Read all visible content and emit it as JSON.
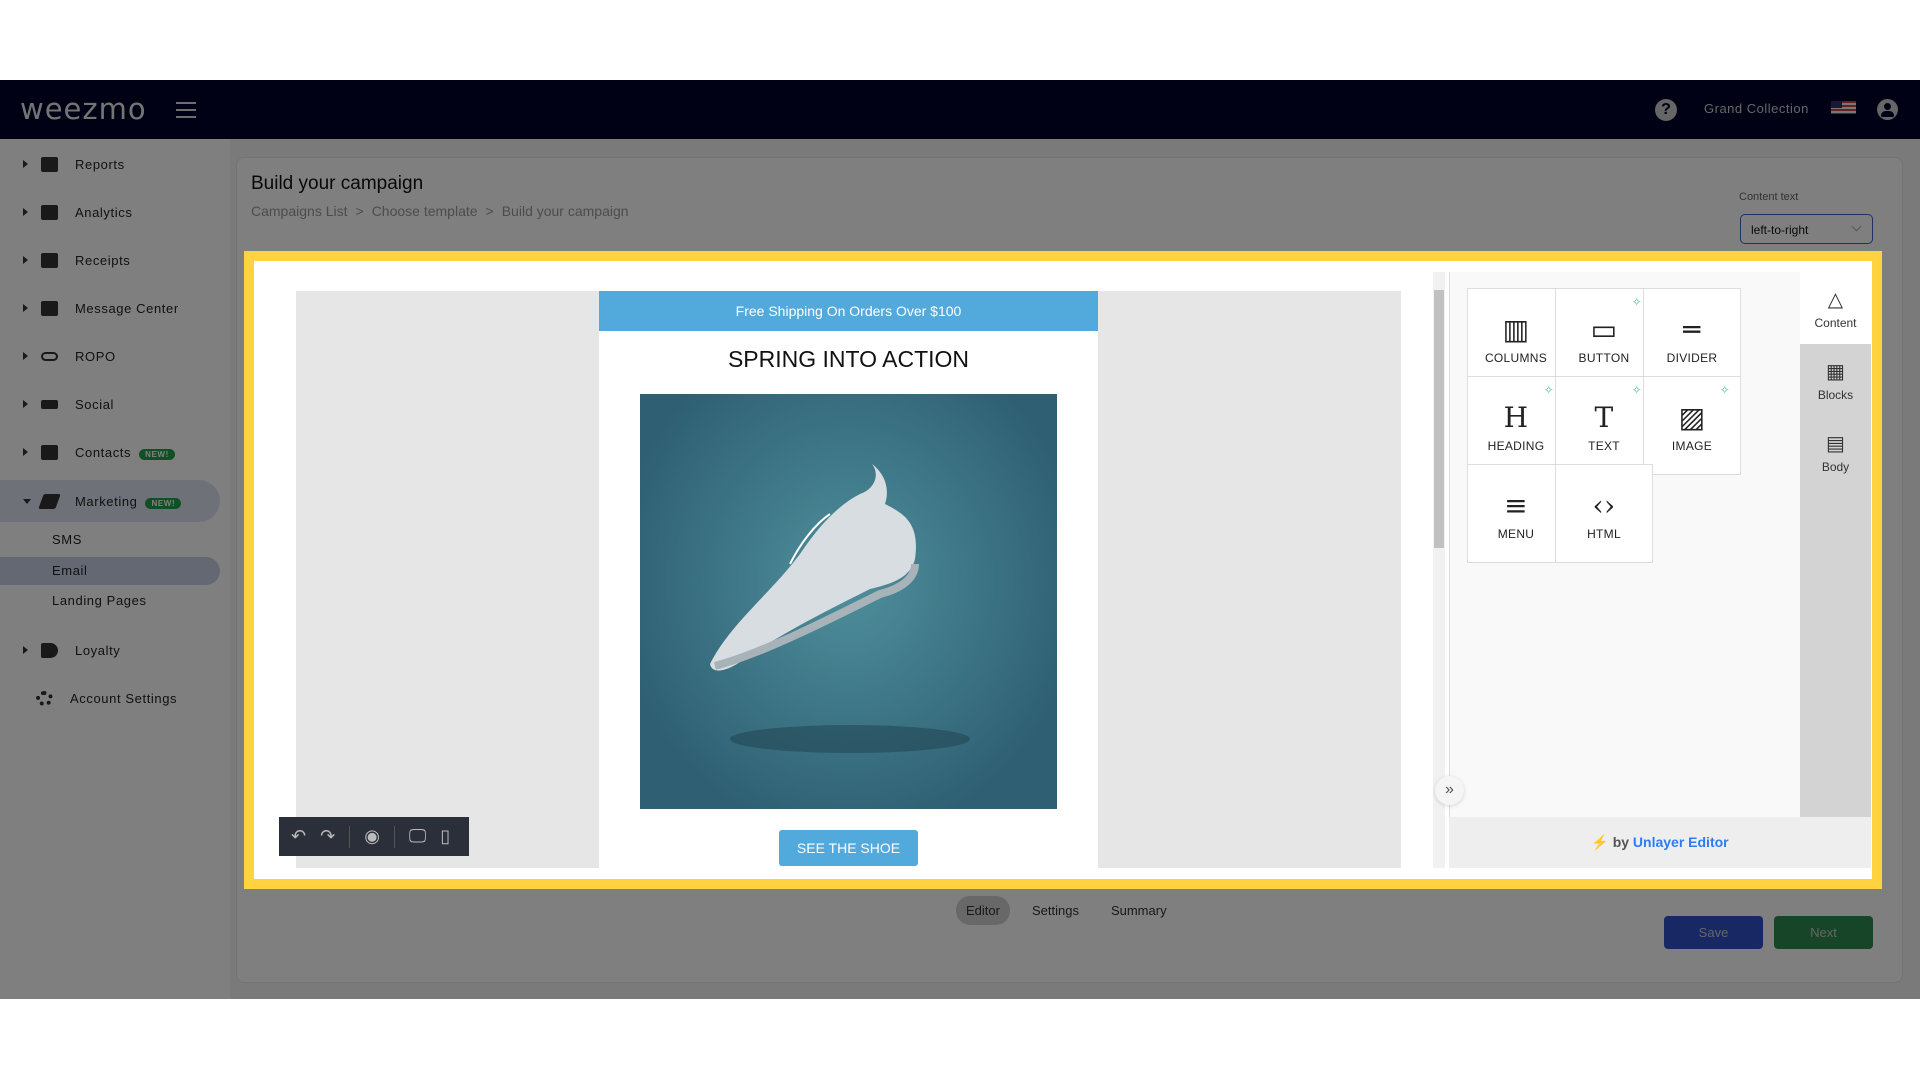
{
  "nav": {
    "logo": "weezmo",
    "org": "Grand Collection",
    "help": "?"
  },
  "sidebar": {
    "items": [
      {
        "label": "Reports"
      },
      {
        "label": "Analytics"
      },
      {
        "label": "Receipts"
      },
      {
        "label": "Message Center"
      },
      {
        "label": "ROPO"
      },
      {
        "label": "Social"
      },
      {
        "label": "Contacts",
        "badge": "NEW!"
      },
      {
        "label": "Marketing",
        "badge": "NEW!"
      }
    ],
    "marketing_sub": [
      "SMS",
      "Email",
      "Landing Pages"
    ],
    "loyalty": "Loyalty",
    "account_settings": "Account Settings"
  },
  "page": {
    "title": "Build your campaign",
    "breadcrumb": [
      "Campaigns List",
      ">",
      "Choose template",
      ">",
      "Build your campaign"
    ],
    "content_text_label": "Content text",
    "content_text_value": "left-to-right"
  },
  "email": {
    "banner": "Free Shipping On Orders Over $100",
    "heading": "SPRING INTO ACTION",
    "cta": "SEE THE SHOE"
  },
  "toolbar": {
    "undo": "↶",
    "redo": "↷",
    "preview": "◉",
    "desktop": "🖵",
    "mobile": "▯"
  },
  "tools": [
    {
      "label": "COLUMNS",
      "icon": "▥",
      "ai": false
    },
    {
      "label": "BUTTON",
      "icon": "▭",
      "ai": true
    },
    {
      "label": "DIVIDER",
      "icon": "═",
      "ai": false
    },
    {
      "label": "HEADING",
      "icon": "H",
      "ai": true
    },
    {
      "label": "TEXT",
      "icon": "T",
      "ai": true
    },
    {
      "label": "IMAGE",
      "icon": "▨",
      "ai": true
    },
    {
      "label": "MENU",
      "icon": "≡",
      "ai": false
    },
    {
      "label": "HTML",
      "icon": "‹›",
      "ai": false
    }
  ],
  "panel_tabs": [
    {
      "label": "Content",
      "icon": "△"
    },
    {
      "label": "Blocks",
      "icon": "▦"
    },
    {
      "label": "Body",
      "icon": "▤"
    }
  ],
  "footer": {
    "bolt": "⚡",
    "by": "by",
    "brand": "Unlayer Editor"
  },
  "bottom_tabs": [
    "Editor",
    "Settings",
    "Summary"
  ],
  "buttons": {
    "save": "Save",
    "next": "Next"
  },
  "colors": {
    "nav": "#03032a",
    "highlight": "#ffd23f",
    "banner": "#52a9dc",
    "save": "#2e50c8",
    "next": "#2e8a4e"
  }
}
